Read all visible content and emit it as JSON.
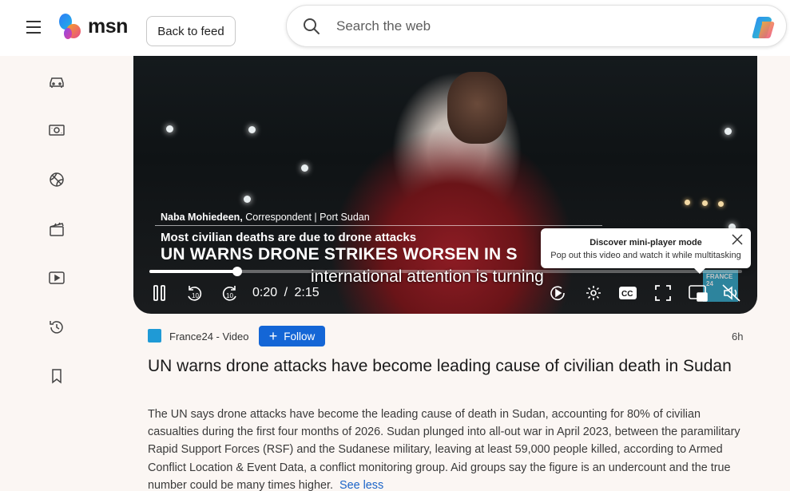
{
  "header": {
    "logo_text": "msn",
    "back_label": "Back to feed",
    "search_placeholder": "Search the web"
  },
  "sidebar": {
    "items": [
      {
        "icon": "car-icon"
      },
      {
        "icon": "money-icon"
      },
      {
        "icon": "sports-icon"
      },
      {
        "icon": "clapperboard-icon"
      },
      {
        "icon": "video-play-icon"
      },
      {
        "icon": "history-icon"
      },
      {
        "icon": "bookmark-icon"
      }
    ]
  },
  "video": {
    "lower_third_name": "Naba Mohiedeen,",
    "lower_third_role": " Correspondent | Port Sudan",
    "lower_third_sub": "Most civilian deaths are due to drone attacks",
    "lower_third_head": "UN WARNS DRONE STRIKES WORSEN IN S",
    "caption": "international attention is turning",
    "time_current": "0:20",
    "time_sep": "/",
    "time_total": "2:15",
    "progress_fraction": 0.148,
    "channel_badge": "FRANCE 24"
  },
  "tooltip": {
    "title": "Discover mini-player mode",
    "text": "Pop out this video and watch it while multitasking"
  },
  "article": {
    "source": "France24 - Video",
    "follow_label": "Follow",
    "age": "6h",
    "title": "UN warns drone attacks have become leading cause of civilian death in Sudan",
    "description": "The UN says drone attacks have become the leading cause of death in Sudan, accounting for 80% of civilian casualties during the first four months of 2026. Sudan plunged into all-out war in April 2023, between the paramilitary Rapid Support Forces (RSF) and the Sudanese military, leaving at least 59,000 people killed, according to Armed Conflict Location & Event Data, a conflict monitoring group. Aid groups say the figure is an undercount and the true number could be many times higher.",
    "see_less": "See less"
  },
  "colors": {
    "accent": "#1466d6",
    "link": "#1a64c8",
    "background": "#fbf6f3"
  }
}
